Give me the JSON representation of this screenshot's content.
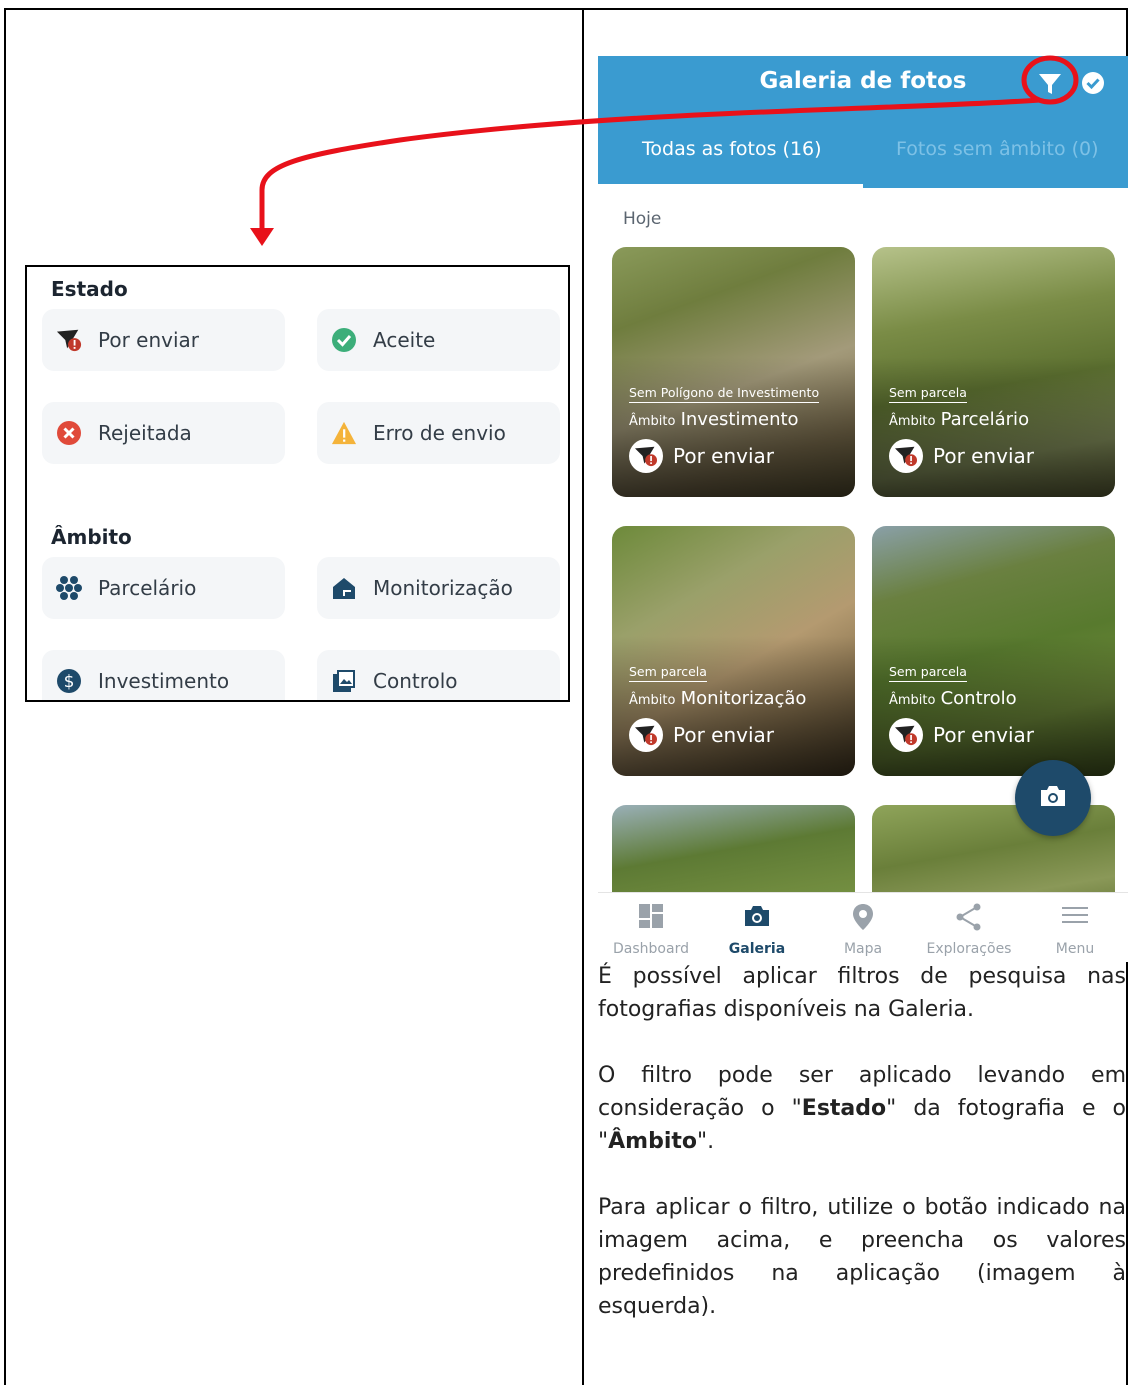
{
  "filter_panel": {
    "estado_heading": "Estado",
    "estado_chips": [
      "Por enviar",
      "Aceite",
      "Rejeitada",
      "Erro de envio"
    ],
    "ambito_heading": "Âmbito",
    "ambito_chips": [
      "Parcelário",
      "Monitorização",
      "Investimento",
      "Controlo"
    ]
  },
  "phone": {
    "title": "Galeria de fotos",
    "tabs": [
      "Todas as fotos (16)",
      "Fotos sem âmbito (0)"
    ],
    "section_label": "Hoje",
    "ambito_key": "Âmbito",
    "cards": [
      {
        "sub": "Sem Polígono de Investimento",
        "ambito": "Investimento",
        "status": "Por enviar"
      },
      {
        "sub": "Sem parcela",
        "ambito": "Parcelário",
        "status": "Por enviar"
      },
      {
        "sub": "Sem parcela",
        "ambito": "Monitorização",
        "status": "Por enviar"
      },
      {
        "sub": "Sem parcela",
        "ambito": "Controlo",
        "status": "Por enviar"
      }
    ],
    "nav": [
      "Dashboard",
      "Galeria",
      "Mapa",
      "Explorações",
      "Menu"
    ],
    "active_nav": "Galeria"
  },
  "description": {
    "p1": "É possível aplicar filtros de pesquisa nas fotografias disponíveis na Galeria.",
    "p2_a": "O filtro pode ser aplicado levando em consideração o \"",
    "p2_b": "Estado",
    "p2_c": "\" da fotografia e o \"",
    "p2_d": "Âmbito",
    "p2_e": "\".",
    "p3": "Para aplicar o filtro, utilize o botão indicado na imagem acima, e preencha os valores predefinidos na aplicação (imagem à esquerda)."
  },
  "colors": {
    "header_blue": "#3a9bd0",
    "annotation_red": "#e8111a",
    "fab": "#1e4a6a",
    "nav_active": "#1e4a6a"
  }
}
